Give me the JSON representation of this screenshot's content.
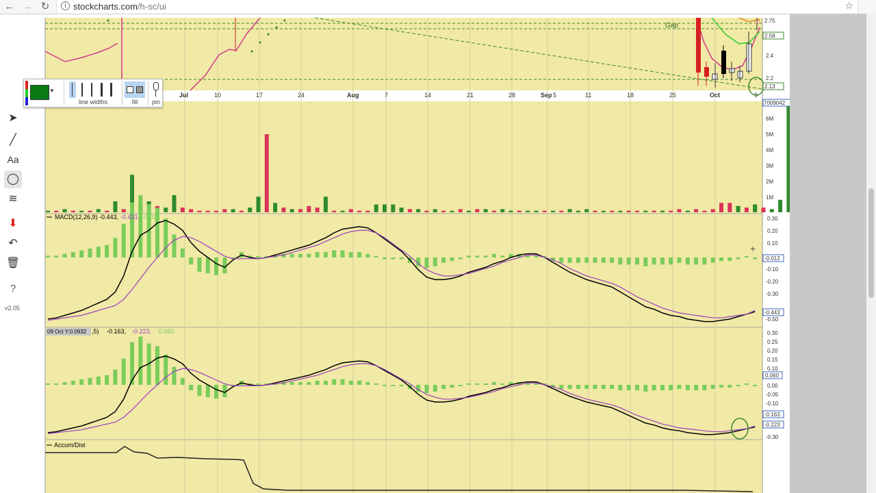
{
  "browser": {
    "url_host": "stockcharts.com",
    "url_path": "/h-sc/ui",
    "back_icon": "arrow-left-icon",
    "forward_icon": "arrow-right-icon",
    "reload_icon": "reload-icon",
    "info_icon": "info-icon",
    "bookmark_icon": "star-icon"
  },
  "toolbar": {
    "tools": [
      "pointer-icon",
      "line-icon",
      "text-icon",
      "circle-icon",
      "fibonacci-icon",
      "save-icon",
      "undo-icon",
      "trash-icon",
      "help-icon"
    ],
    "text_tool_label": "Aa",
    "help_label": "?",
    "version": "v2.05"
  },
  "palette": {
    "color": "#0a7a12",
    "line_widths_label": "line widths",
    "fill_label": "fill",
    "pin_label": "pin"
  },
  "price_panel": {
    "gap_label": "Gap",
    "x_labels": [
      "Jul",
      "10",
      "17",
      "24",
      "Aug",
      "7",
      "14",
      "21",
      "28",
      "Sep",
      "5",
      "11",
      "18",
      "25",
      "Oct",
      "9"
    ],
    "y_labels": [
      "2.75",
      "2.58",
      "2.4",
      "2.2",
      "2.13"
    ]
  },
  "volume_panel": {
    "top_value": "7009042",
    "y_labels": [
      "6M",
      "5M",
      "4M",
      "3M",
      "2M",
      "1M"
    ]
  },
  "macd_panel": {
    "title": "MACD(12,26,9)",
    "v1": "-0.443,",
    "v2": "-0.431,",
    "v3": "-0.012",
    "y_labels": [
      "0.30",
      "0.20",
      "0.10",
      "0.00",
      "-0.10",
      "-0.20",
      "-0.30",
      "-0.40",
      "-0.50"
    ],
    "tag_hist": "-0.012",
    "tag_macd": "-0.443",
    "tag_signal": "-0.431"
  },
  "ppo_panel": {
    "tooltip": "09 Oct Y:0.0932",
    "title_tail": ",5)",
    "v1": "-0.163,",
    "v2": "-0.223,",
    "v3": "0.060",
    "y_labels": [
      "0.30",
      "0.25",
      "0.20",
      "0.15",
      "0.10",
      "0.05",
      "0.00",
      "-0.05",
      "-0.10",
      "-0.15",
      "-0.20",
      "-0.25",
      "-0.30"
    ],
    "tag_hist": "0.060",
    "tag_line1": "-0.163",
    "tag_line2": "-0.223"
  },
  "accum_panel": {
    "title": "Accum/Dist"
  },
  "colors": {
    "panel_bg": "#f1e9a6",
    "up_bar": "#2e8b2e",
    "down_bar": "#d9345a",
    "hist_bar": "#7acc5a",
    "macd_line": "#000000",
    "signal_line": "#9a3fbf",
    "annotation_green": "#3a8a2a"
  }
}
